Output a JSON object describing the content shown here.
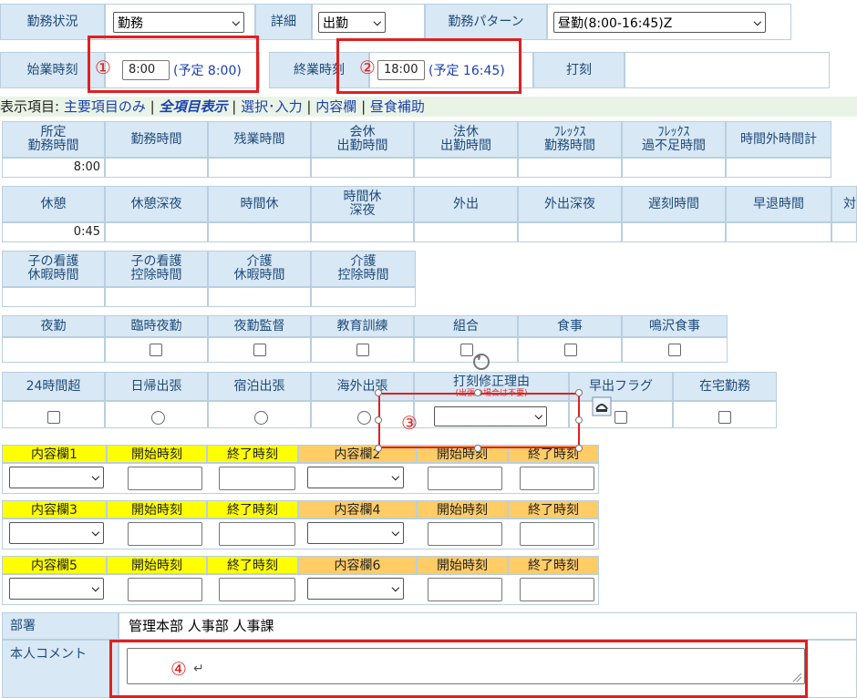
{
  "header": {
    "status_label": "勤務状況",
    "status_value": "勤務",
    "detail_label": "詳細",
    "detail_value": "出勤",
    "pattern_label": "勤務パターン",
    "pattern_value": "昼勤(8:00-16:45)Z"
  },
  "times": {
    "start_label": "始業時刻",
    "start_value": "8:00",
    "start_planned": "(予定 8:00)",
    "end_label": "終業時刻",
    "end_value": "18:00",
    "end_planned": "(予定 16:45)",
    "stamp_label": "打刻"
  },
  "display_nav": {
    "prefix": "表示項目:",
    "items": [
      "主要項目のみ",
      "全項目表示",
      "選択･入力",
      "内容欄",
      "昼食補助"
    ],
    "sep": "|"
  },
  "grid1": {
    "headers": [
      "所定\n勤務時間",
      "勤務時間",
      "残業時間",
      "会休\n出勤時間",
      "法休\n出勤時間",
      "ﾌﾚｯｸｽ\n勤務時間",
      "ﾌﾚｯｸｽ\n過不足時間",
      "時間外時間計"
    ],
    "first_value": "8:00"
  },
  "grid2": {
    "headers": [
      "休憩",
      "休憩深夜",
      "時間休",
      "時間休\n深夜",
      "外出",
      "外出深夜",
      "遅刻時間",
      "早退時間"
    ],
    "first_value": "0:45",
    "overflow_char": "対"
  },
  "grid3": {
    "headers": [
      "子の看護\n休暇時間",
      "子の看護\n控除時間",
      "介護\n休暇時間",
      "介護\n控除時間"
    ]
  },
  "grid4": {
    "headers": [
      "夜勤",
      "臨時夜勤",
      "夜勤監督",
      "教育訓練",
      "組合",
      "食事",
      "鳴沢食事"
    ]
  },
  "grid5": {
    "headers": [
      "24時間超",
      "日帰出張",
      "宿泊出張",
      "海外出張",
      "打刻修正理由",
      "早出フラグ",
      "在宅勤務"
    ],
    "reason_note": "(出張の場合は不要)"
  },
  "content_rows": [
    {
      "a": "内容欄1",
      "b": "内容欄2"
    },
    {
      "a": "内容欄3",
      "b": "内容欄4"
    },
    {
      "a": "内容欄5",
      "b": "内容欄6"
    }
  ],
  "content_common": {
    "start": "開始時刻",
    "end": "終了時刻"
  },
  "dept": {
    "label": "部署",
    "value": "管理本部 人事部 人事課"
  },
  "comment": {
    "label": "本人コメント"
  },
  "markers": [
    "①",
    "②",
    "③",
    "④"
  ],
  "marker_arrow": "↵"
}
